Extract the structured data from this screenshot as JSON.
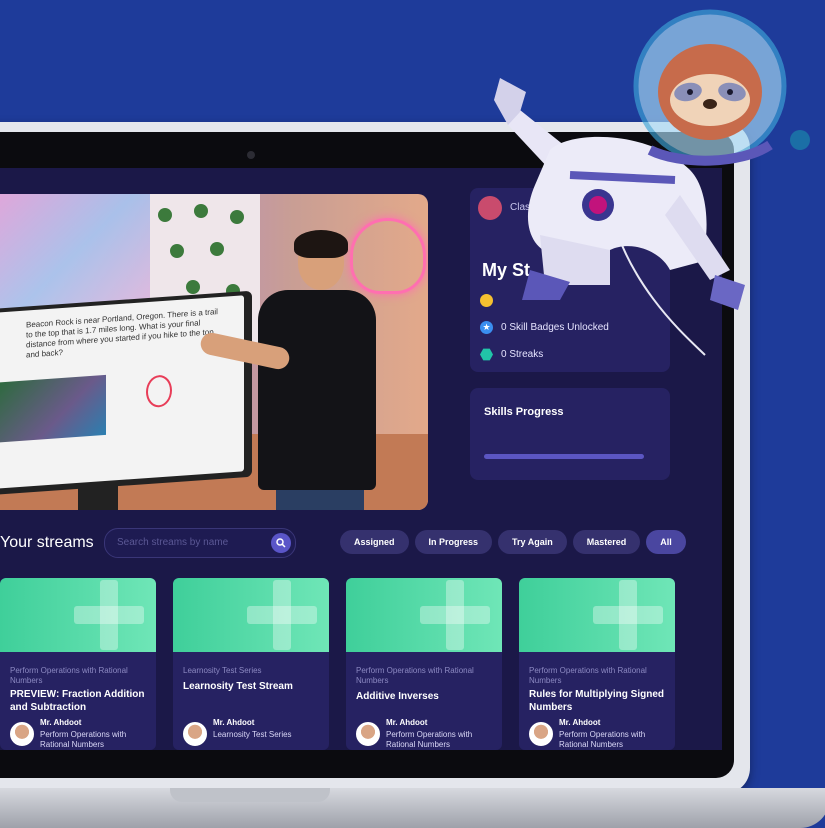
{
  "video": {
    "board_text": "Beacon Rock is near Portland, Oregon. There is a trail to the top that is 1.7 miles long. What is your final distance from where you started if you hike to the top and back?"
  },
  "stats": {
    "class_label": "Clas",
    "title": "My St",
    "rows": [
      {
        "icon": "coin-icon",
        "label": ""
      },
      {
        "icon": "star-badge-icon",
        "label": "0 Skill Badges Unlocked"
      },
      {
        "icon": "hexagon-streak-icon",
        "label": "0 Streaks"
      }
    ]
  },
  "skills": {
    "title": "Skills Progress"
  },
  "streams": {
    "title": "Your streams",
    "search_placeholder": "Search streams by name",
    "filters": [
      "Assigned",
      "In Progress",
      "Try Again",
      "Mastered",
      "All"
    ],
    "active_filter": "All"
  },
  "cards": [
    {
      "category": "Perform Operations with Rational Numbers",
      "title": "PREVIEW: Fraction Addition and Subtraction",
      "author": "Mr. Ahdoot",
      "subtitle": "Perform Operations with Rational Numbers"
    },
    {
      "category": "Learnosity Test Series",
      "title": "Learnosity Test Stream",
      "author": "Mr. Ahdoot",
      "subtitle": "Learnosity Test Series"
    },
    {
      "category": "Perform Operations with Rational Numbers",
      "title": "Additive Inverses",
      "author": "Mr. Ahdoot",
      "subtitle": "Perform Operations with Rational Numbers"
    },
    {
      "category": "Perform Operations with Rational Numbers",
      "title": "Rules for Multiplying Signed Numbers",
      "author": "Mr. Ahdoot",
      "subtitle": "Perform Operations with Rational Numbers"
    }
  ],
  "colors": {
    "background": "#1e3b9a",
    "screen": "#1b1848",
    "panel": "#262262",
    "accent_green": "#3fcf9a",
    "accent_purple": "#5a55c8"
  }
}
